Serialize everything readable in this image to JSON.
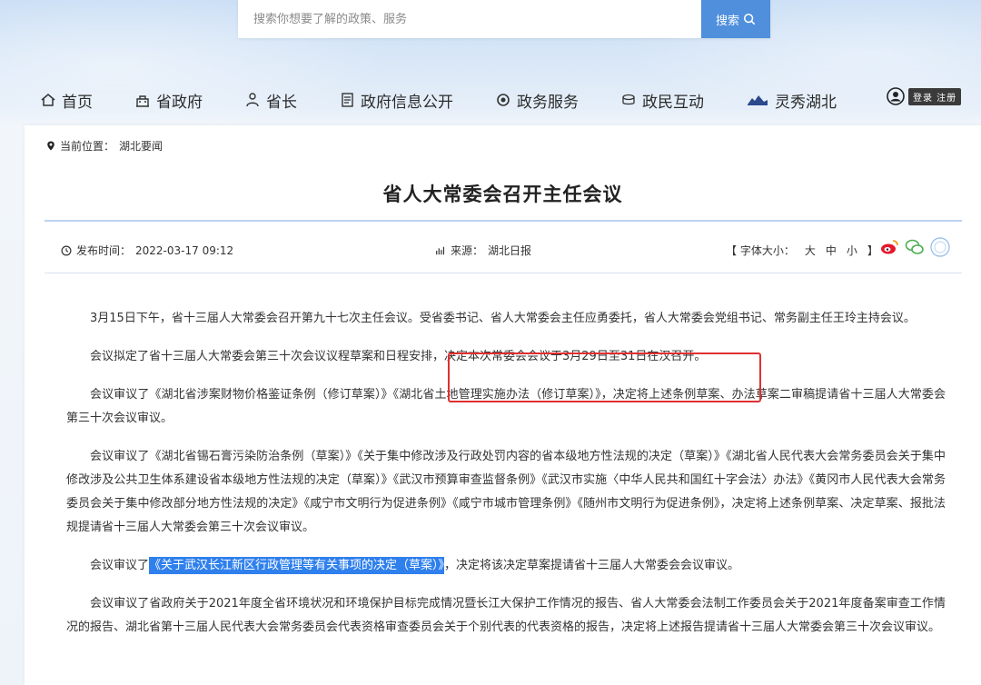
{
  "search": {
    "placeholder": "搜索你想要了解的政策、服务",
    "button_label": "搜索"
  },
  "nav": {
    "items": [
      {
        "label": "首页",
        "icon": "home-icon"
      },
      {
        "label": "省政府",
        "icon": "building-icon"
      },
      {
        "label": "省长",
        "icon": "person-icon"
      },
      {
        "label": "政府信息公开",
        "icon": "document-icon"
      },
      {
        "label": "政务服务",
        "icon": "service-icon"
      },
      {
        "label": "政民互动",
        "icon": "chat-icon"
      },
      {
        "label": "灵秀湖北",
        "icon": "landscape-icon"
      }
    ],
    "user_label": "登录 注册"
  },
  "article": {
    "breadcrumb_prefix": "当前位置：",
    "breadcrumb_current": "湖北要闻",
    "title": "省人大常委会召开主任会议",
    "publish_label": "发布时间：",
    "publish_time": "2022-03-17 09:12",
    "source_label": "来源：",
    "source": "湖北日报",
    "font_size_label": "【 字体大小：",
    "font_sizes": [
      "大",
      "中",
      "小"
    ],
    "font_size_close": "】",
    "paragraphs": {
      "p1": "3月15日下午，省十三届人大常委会召开第九十七次主任会议。受省委书记、省人大常委会主任应勇委托，省人大常委会党组书记、常务副主任王玲主持会议。",
      "p2": "会议拟定了省十三届人大常委会第三十次会议议程草案和日程安排，决定本次常委会会议于3月29日至31日在汉召开。",
      "p3": "会议审议了《湖北省涉案财物价格鉴证条例（修订草案）》《湖北省土地管理实施办法（修订草案）》，决定将上述条例草案、办法草案二审稿提请省十三届人大常委会第三十次会议审议。",
      "p4": "会议审议了《湖北省锡石膏污染防治条例（草案）》《关于集中修改涉及行政处罚内容的省本级地方性法规的决定（草案）》《湖北省人民代表大会常务委员会关于集中修改涉及公共卫生体系建设省本级地方性法规的决定（草案）》《武汉市预算审查监督条例》《武汉市实施〈中华人民共和国红十字会法〉办法》《黄冈市人民代表大会常务委员会关于集中修改部分地方性法规的决定》《咸宁市文明行为促进条例》《咸宁市城市管理条例》《随州市文明行为促进条例》，决定将上述条例草案、决定草案、报批法规提请省十三届人大常委会第三十次会议审议。",
      "p5_before": "会议审议了",
      "p5_highlight": "《关于武汉长江新区行政管理等有关事项的决定（草案）》",
      "p5_after": "，决定将该决定草案提请省十三届人大常委会会议审议。",
      "p6": "会议审议了省政府关于2021年度全省环境状况和环境保护目标完成情况暨长江大保护工作情况的报告、省人大常委会法制工作委员会关于2021年度备案审查工作情况的报告、湖北省第十三届人民代表大会常务委员会代表资格审查委员会关于个别代表的代表资格的报告，决定将上述报告提请省十三届人大常委会第三十次会议审议。"
    }
  },
  "colors": {
    "accent": "#4f8fdc",
    "highlight": "#2f80ed",
    "annotation_box": "#e03030"
  }
}
